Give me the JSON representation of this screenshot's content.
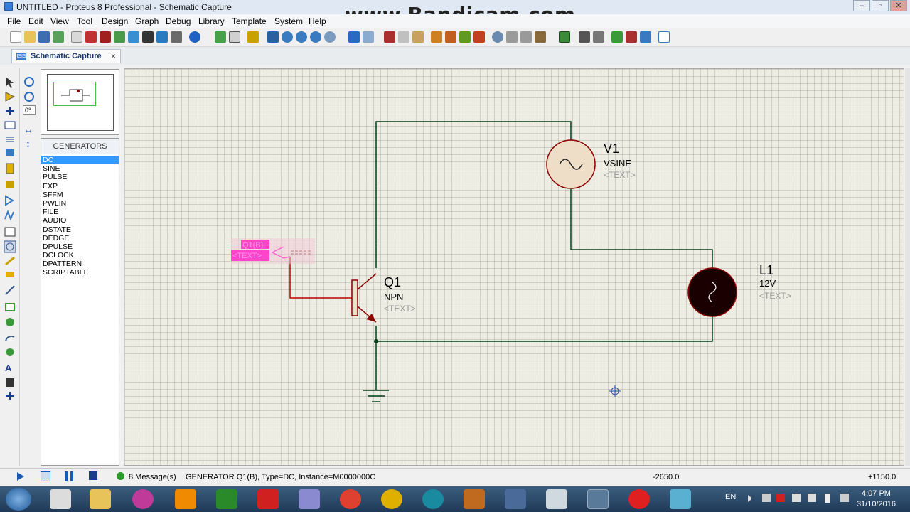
{
  "window": {
    "title": "UNTITLED - Proteus 8 Professional - Schematic Capture",
    "watermark": "www.Bandicam.com",
    "min": "–",
    "max": "▫",
    "close": "✕"
  },
  "menu": [
    "File",
    "Edit",
    "View",
    "Tool",
    "Design",
    "Graph",
    "Debug",
    "Library",
    "Template",
    "System",
    "Help"
  ],
  "tab": {
    "label": "Schematic Capture",
    "icon_text": "ISIS",
    "close": "×"
  },
  "rotation": {
    "angle": "0°"
  },
  "device_panel": {
    "header": "GENERATORS",
    "items": [
      "DC",
      "SINE",
      "PULSE",
      "EXP",
      "SFFM",
      "PWLIN",
      "FILE",
      "AUDIO",
      "DSTATE",
      "DEDGE",
      "DPULSE",
      "DCLOCK",
      "DPATTERN",
      "SCRIPTABLE"
    ],
    "selected": "DC"
  },
  "schematic": {
    "generator": {
      "name": "Q1(B)",
      "text": "<TEXT>"
    },
    "transistor": {
      "ref": "Q1",
      "type": "NPN",
      "text": "<TEXT>"
    },
    "source": {
      "ref": "V1",
      "type": "VSINE",
      "text": "<TEXT>"
    },
    "lamp": {
      "ref": "L1",
      "value": "12V",
      "text": "<TEXT>"
    },
    "colors": {
      "wire": "#00401a",
      "red_wire": "#c00000",
      "component": "#8b0000",
      "body": "#eeddc7",
      "highlight": "#ff44cc"
    }
  },
  "status": {
    "messages": "8 Message(s)",
    "info": "GENERATOR Q1(B), Type=DC, Instance=M0000000C",
    "x_coord": "-2650.0",
    "y_coord": "+1150.0"
  },
  "taskbar": {
    "language": "EN",
    "time": "4:07 PM",
    "date": "31/10/2016"
  }
}
